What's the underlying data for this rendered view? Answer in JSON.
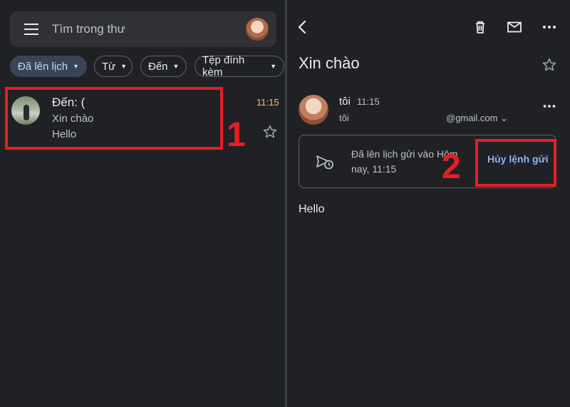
{
  "search": {
    "placeholder": "Tìm trong thư",
    "menu_icon": "menu-icon",
    "avatar_icon": "account-avatar"
  },
  "filters": {
    "scheduled": "Đã lên lịch",
    "from": "Từ",
    "to": "Đến",
    "attachment": "Tệp đính kèm"
  },
  "list": {
    "rows": [
      {
        "to": "Đến: (",
        "subject": "Xin chào",
        "snippet": "Hello",
        "time": "11:15"
      }
    ]
  },
  "annotations": {
    "step1": "1",
    "step2": "2",
    "color": "#e61e25"
  },
  "message": {
    "subject": "Xin chào",
    "sender_name": "tôi",
    "time": "11:15",
    "to": "tôi",
    "email": "@gmail.com ⌄",
    "scheduled_text": "Đã lên lịch gửi vào Hôm nay, 11:15",
    "cancel_label": "Hủy lệnh gửi",
    "body": "Hello"
  },
  "colors": {
    "background": "#202124",
    "accent": "#8ab4f8",
    "time_highlight": "#f6bf6b"
  }
}
